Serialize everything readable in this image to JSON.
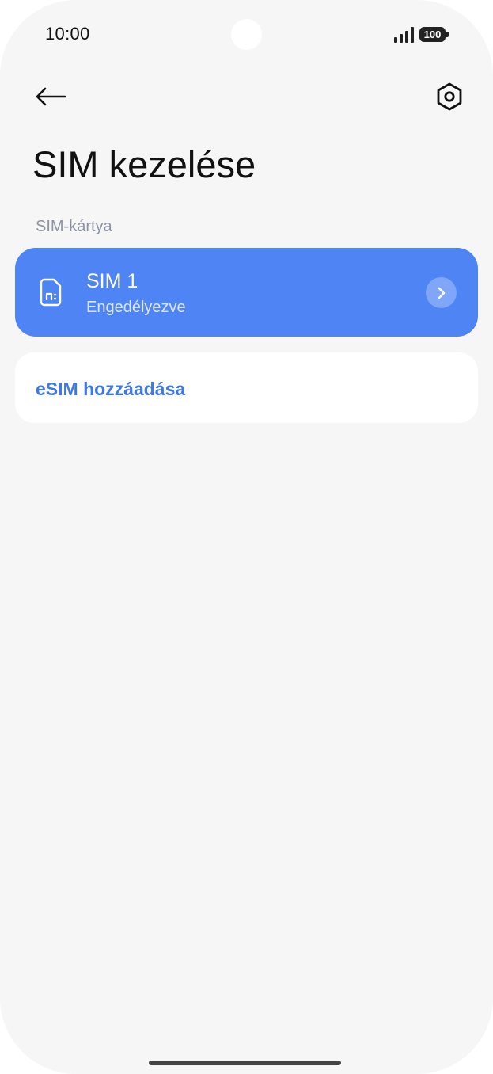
{
  "status_bar": {
    "time": "10:00",
    "battery_level": "100",
    "icons": [
      "signal-icon",
      "battery-icon"
    ]
  },
  "toolbar": {
    "back_icon": "arrow-left-icon",
    "settings_icon": "hexagon-gear-icon"
  },
  "page": {
    "title": "SIM kezelése"
  },
  "sections": {
    "sim_card_label": "SIM-kártya"
  },
  "sim_slots": [
    {
      "name": "SIM 1",
      "status": "Engedélyezve",
      "icon": "sim-card-icon",
      "chevron_icon": "chevron-right-icon"
    }
  ],
  "actions": {
    "add_esim_label": "eSIM hozzáadása"
  },
  "colors": {
    "accent": "#4f84f5",
    "link": "#3f78e6",
    "background": "#f6f6f6",
    "section_label": "#8c93a3"
  }
}
